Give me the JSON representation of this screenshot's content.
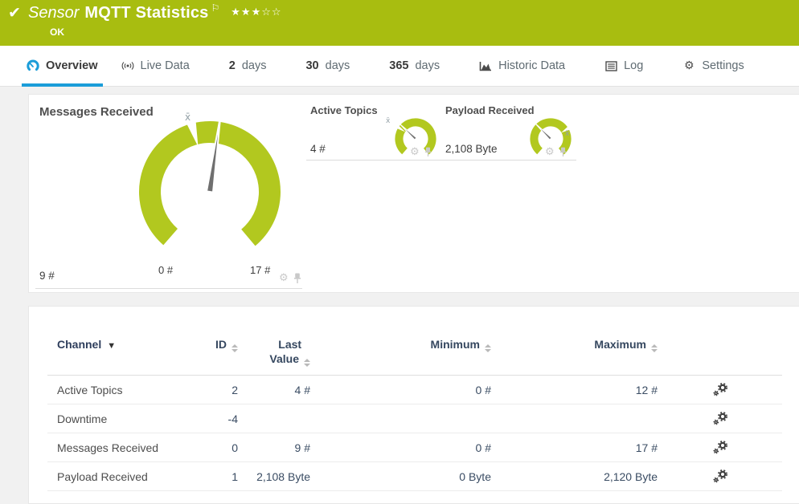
{
  "header": {
    "check_icon": "✔",
    "kind": "Sensor",
    "title": "MQTT Statistics",
    "flag_icon": "⚐",
    "stars": "★★★☆☆",
    "status": "OK"
  },
  "tabs": {
    "overview": "Overview",
    "live_data": "Live Data",
    "days2_num": "2",
    "days2_label": "days",
    "days30_num": "30",
    "days30_label": "days",
    "days365_num": "365",
    "days365_label": "days",
    "historic": "Historic Data",
    "log": "Log",
    "settings": "Settings"
  },
  "gauges": {
    "primary": {
      "title": "Messages Received",
      "value": "9 #",
      "scale_min": "0 #",
      "scale_max": "17 #",
      "avg_marker": "x̄"
    },
    "mini1": {
      "title": "Active Topics",
      "value": "4 #",
      "avg_marker": "x̄"
    },
    "mini2": {
      "title": "Payload Received",
      "value": "2,108 Byte",
      "avg_marker": "x̄"
    }
  },
  "table": {
    "headers": {
      "channel": "Channel",
      "id": "ID",
      "last_line1": "Last",
      "last_line2": "Value",
      "minimum": "Minimum",
      "maximum": "Maximum"
    },
    "rows": [
      {
        "channel": "Active Topics",
        "id": "2",
        "last": "4 #",
        "min": "0 #",
        "max": "12 #"
      },
      {
        "channel": "Downtime",
        "id": "-4",
        "last": "",
        "min": "",
        "max": ""
      },
      {
        "channel": "Messages Received",
        "id": "0",
        "last": "9 #",
        "min": "0 #",
        "max": "17 #"
      },
      {
        "channel": "Payload Received",
        "id": "1",
        "last": "2,108 Byte",
        "min": "0 Byte",
        "max": "2,120 Byte"
      }
    ]
  },
  "colors": {
    "status_green": "#a8bd10",
    "gauge_green": "#b2c81f",
    "accent_blue": "#1b9dd9",
    "header_text": "#35475f"
  }
}
